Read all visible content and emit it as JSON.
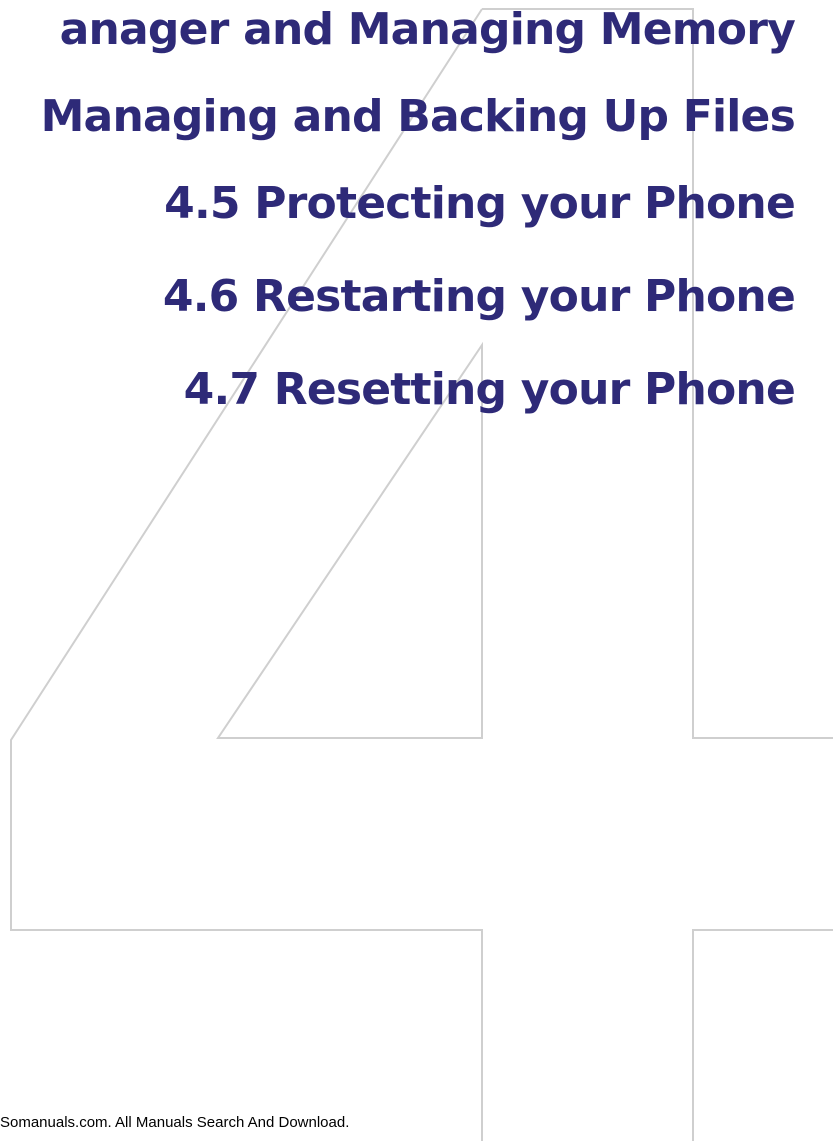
{
  "toc": {
    "items": [
      "anager and Managing Memory",
      "Managing and Backing Up Files",
      "4.5  Protecting your Phone",
      "4.6  Restarting your Phone",
      "4.7  Resetting your Phone"
    ]
  },
  "chapter_numeral": "4",
  "footer": {
    "text": "Somanuals.com. All Manuals Search And Download."
  },
  "colors": {
    "heading": "#2e2a78",
    "outline": "#cfcfcf",
    "background": "#ffffff"
  }
}
